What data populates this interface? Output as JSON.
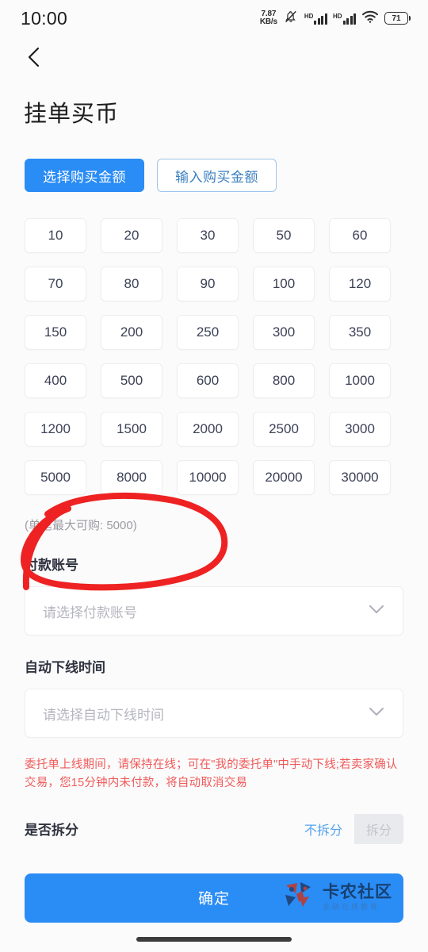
{
  "status_bar": {
    "time": "10:00",
    "net_speed_value": "7.87",
    "net_speed_unit": "KB/s",
    "mute_icon": "bell-mute-icon",
    "signal_1_label": "HD",
    "signal_2_label": "HD",
    "wifi_icon": "wifi-icon",
    "battery_level": "71"
  },
  "nav": {
    "back_icon": "chevron-left-icon"
  },
  "header": {
    "title": "挂单买币"
  },
  "mode_tabs": [
    {
      "label": "选择购买金额",
      "active": true
    },
    {
      "label": "输入购买金额",
      "active": false
    }
  ],
  "amounts": [
    "10",
    "20",
    "30",
    "50",
    "60",
    "70",
    "80",
    "90",
    "100",
    "120",
    "150",
    "200",
    "250",
    "300",
    "350",
    "400",
    "500",
    "600",
    "800",
    "1000",
    "1200",
    "1500",
    "2000",
    "2500",
    "3000",
    "5000",
    "8000",
    "10000",
    "20000",
    "30000"
  ],
  "max_hint": "(单笔最大可购: 5000)",
  "payment_account": {
    "label": "付款账号",
    "placeholder": "请选择付款账号",
    "value": "",
    "chevron_icon": "chevron-down-icon"
  },
  "auto_offline_time": {
    "label": "自动下线时间",
    "placeholder": "请选择自动下线时间",
    "value": "",
    "chevron_icon": "chevron-down-icon"
  },
  "warning_text": "委托单上线期间，请保持在线；可在\"我的委托单\"中手动下线;若卖家确认交易，您15分钟内未付款，将自动取消交易",
  "split": {
    "label": "是否拆分",
    "options": [
      {
        "label": "不拆分",
        "selected": true
      },
      {
        "label": "拆分",
        "selected": false
      }
    ]
  },
  "submit": {
    "label": "确定"
  },
  "watermark": {
    "title": "卡农社区",
    "subtitle": "金融在线教育",
    "logo_icon": "pinwheel-logo-icon"
  },
  "annotation": {
    "type": "hand-drawn-ellipse",
    "color": "#ee2222"
  },
  "colors": {
    "accent": "#2a8cf5",
    "warning": "#f05a5a",
    "background": "#fbfbfb",
    "card": "#ffffff",
    "annotation": "#ee2222"
  }
}
